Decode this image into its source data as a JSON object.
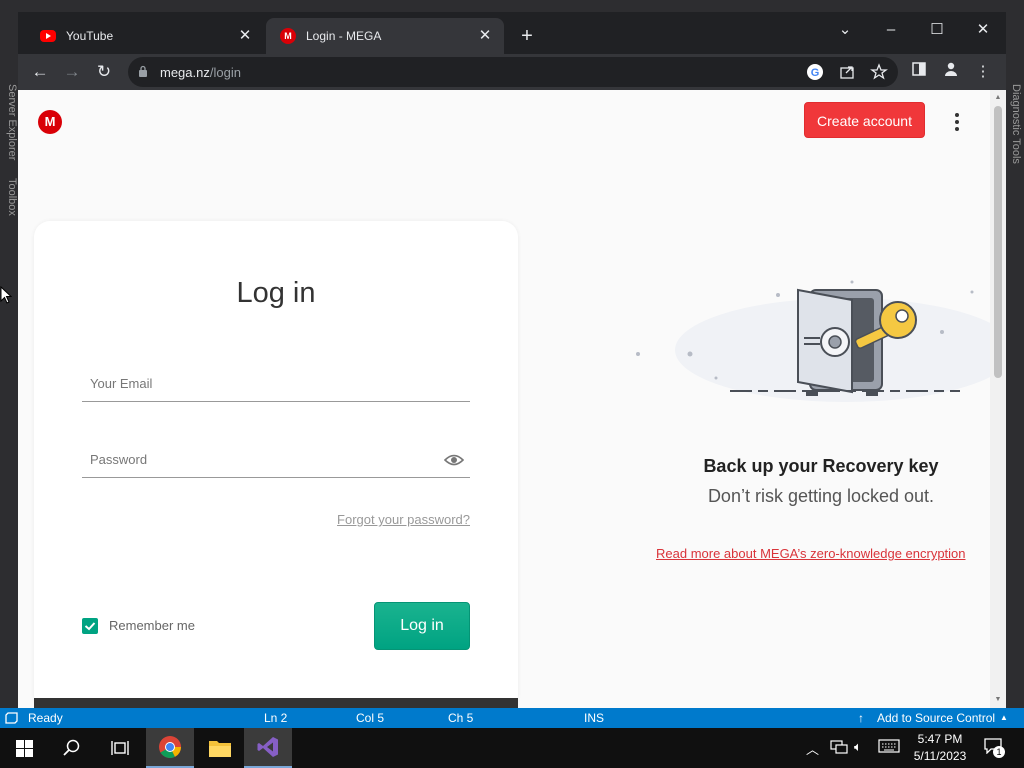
{
  "ide": {
    "left_panel_labels": [
      "Server Explorer",
      "Toolbox"
    ],
    "right_panel_label": "Diagnostic Tools",
    "status": {
      "ready": "Ready",
      "line": "Ln 2",
      "col": "Col 5",
      "ch": "Ch 5",
      "ins": "INS",
      "source_control": "Add to Source Control"
    }
  },
  "browser": {
    "tabs": [
      {
        "title": "YouTube",
        "icon": "youtube-icon",
        "active": false
      },
      {
        "title": "Login - MEGA",
        "icon": "mega-icon",
        "active": true
      }
    ],
    "url_host": "mega.nz",
    "url_path": "/login"
  },
  "page": {
    "logo_letter": "M",
    "create_account": "Create account",
    "login_title": "Log in",
    "email_placeholder": "Your Email",
    "password_placeholder": "Password",
    "forgot_password": "Forgot your password?",
    "remember_me": "Remember me",
    "remember_checked": true,
    "login_button": "Log in",
    "recovery_title": "Back up your Recovery key",
    "recovery_subtitle": "Don’t risk getting locked out.",
    "read_more": "Read more about MEGA’s zero-knowledge encryption"
  },
  "colors": {
    "mega_red": "#d90007",
    "create_button": "#f0373a",
    "login_green": "#00a382",
    "link_red": "#d9343a",
    "statusbar_blue": "#007acc"
  },
  "taskbar": {
    "time": "5:47 PM",
    "date": "5/11/2023",
    "notification_count": "1"
  }
}
